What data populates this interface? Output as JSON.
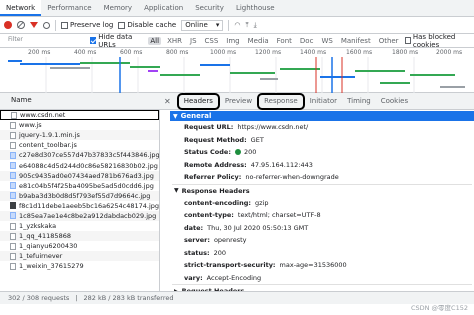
{
  "tabs": [
    "Network",
    "Performance",
    "Memory",
    "Application",
    "Security",
    "Lighthouse"
  ],
  "toolbar": {
    "preserve_log": "Preserve log",
    "disable_cache": "Disable cache",
    "throttle": "Online"
  },
  "filterbar": {
    "placeholder": "Filter",
    "hide_data_urls": "Hide data URLs",
    "types": [
      "All",
      "XHR",
      "JS",
      "CSS",
      "Img",
      "Media",
      "Font",
      "Doc",
      "WS",
      "Manifest",
      "Other"
    ],
    "has_blocked": "Has blocked cookies"
  },
  "timeline_ticks": [
    "200 ms",
    "400 ms",
    "600 ms",
    "800 ms",
    "1000 ms",
    "1200 ms",
    "1400 ms",
    "1600 ms",
    "1800 ms",
    "2000 ms"
  ],
  "table": {
    "name_header": "Name"
  },
  "files": [
    {
      "name": "www.csdn.net",
      "icon": "doc"
    },
    {
      "name": "www.js",
      "icon": "doc"
    },
    {
      "name": "jquery-1.9.1.min.js",
      "icon": "doc"
    },
    {
      "name": "content_toolbar.js",
      "icon": "doc"
    },
    {
      "name": "c27e8d307ce557d47b37833c5f443846.jpg",
      "icon": "img"
    },
    {
      "name": "e64088c4d5d244d0c86e58216830b02.jpg",
      "icon": "img"
    },
    {
      "name": "905c9435ad0e07434aed781b676ad3.jpg",
      "icon": "img"
    },
    {
      "name": "e81c04b5f4f25ba4095be5ad5d0cdd6.jpg",
      "icon": "img"
    },
    {
      "name": "b9aba3d3b0d8d5f793ef55d7d9664c.jpg",
      "icon": "img"
    },
    {
      "name": "f8c1d11debe1aeeb5bc16a6254c48174.jpg",
      "icon": "dark"
    },
    {
      "name": "1c85ea7ae1e4c8be2a912dabdacb029.jpg",
      "icon": "img"
    },
    {
      "name": "1_yzkskaka",
      "icon": "doc"
    },
    {
      "name": "1_qq_41185868",
      "icon": "doc"
    },
    {
      "name": "1_qianyu6200430",
      "icon": "doc"
    },
    {
      "name": "1_tefuirnever",
      "icon": "doc"
    },
    {
      "name": "1_weixin_37615279",
      "icon": "doc"
    }
  ],
  "status": {
    "requests": "302 / 308 requests",
    "transferred": "282 kB / 283 kB transferred"
  },
  "detail_tabs": [
    "Headers",
    "Preview",
    "Response",
    "Initiator",
    "Timing",
    "Cookies"
  ],
  "general": {
    "title": "General",
    "rows": [
      {
        "k": "Request URL:",
        "v": "https://www.csdn.net/"
      },
      {
        "k": "Request Method:",
        "v": "GET"
      },
      {
        "k": "Status Code:",
        "v": "200"
      },
      {
        "k": "Remote Address:",
        "v": "47.95.164.112:443"
      },
      {
        "k": "Referrer Policy:",
        "v": "no-referrer-when-downgrade"
      }
    ]
  },
  "response_headers": {
    "title": "Response Headers",
    "rows": [
      {
        "k": "content-encoding:",
        "v": "gzip"
      },
      {
        "k": "content-type:",
        "v": "text/html; charset=UTF-8"
      },
      {
        "k": "date:",
        "v": "Thu, 30 Jul 2020 05:50:13 GMT"
      },
      {
        "k": "server:",
        "v": "openresty"
      },
      {
        "k": "status:",
        "v": "200"
      },
      {
        "k": "strict-transport-security:",
        "v": "max-age=31536000"
      },
      {
        "k": "vary:",
        "v": "Accept-Encoding"
      }
    ]
  },
  "request_headers": {
    "title": "Request Headers"
  },
  "watermark": "CSDN @零度C152"
}
